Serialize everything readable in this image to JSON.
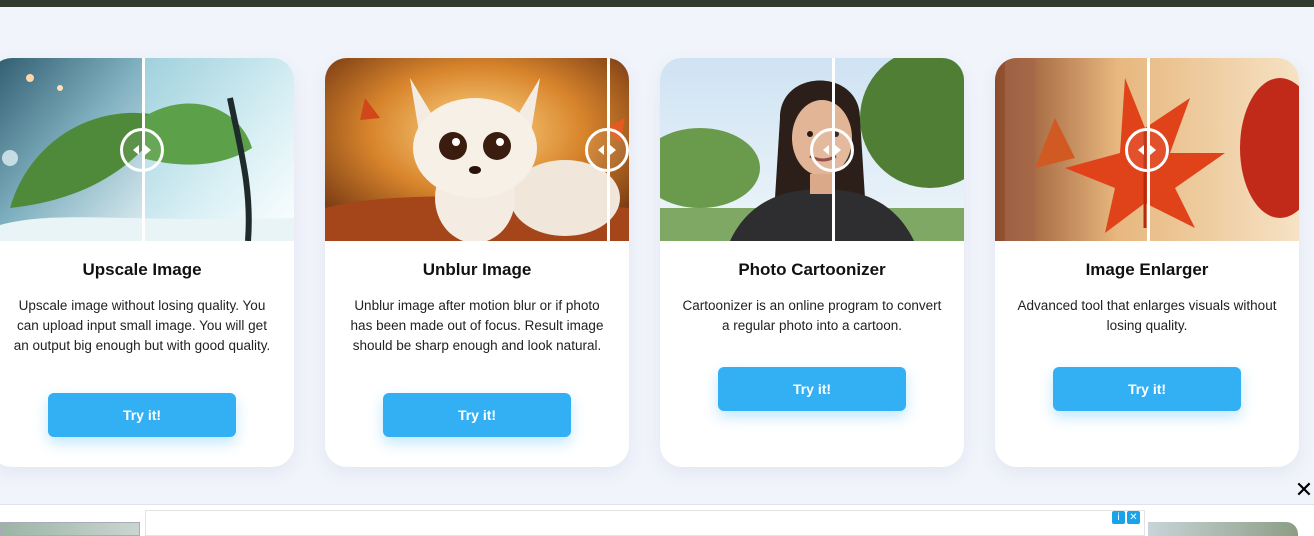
{
  "cards": [
    {
      "title": "Upscale Image",
      "description": "Upscale image without losing quality. You can upload input small image. You will get an output big enough but with good quality.",
      "button": "Try it!"
    },
    {
      "title": "Unblur Image",
      "description": "Unblur image after motion blur or if photo has been made out of focus. Result image should be sharp enough and look natural.",
      "button": "Try it!"
    },
    {
      "title": "Photo Cartoonizer",
      "description": "Cartoonizer is an online program to convert a regular photo into a cartoon.",
      "button": "Try it!"
    },
    {
      "title": "Image Enlarger",
      "description": "Advanced tool that enlarges visuals without losing quality.",
      "button": "Try it!"
    }
  ],
  "ad": {
    "close_glyph": "✕",
    "info_glyph": "i",
    "x_glyph": "✕"
  },
  "colors": {
    "accent": "#33b0f4",
    "page_bg": "#f1f4fb",
    "top_bar": "#2f3b2c"
  }
}
